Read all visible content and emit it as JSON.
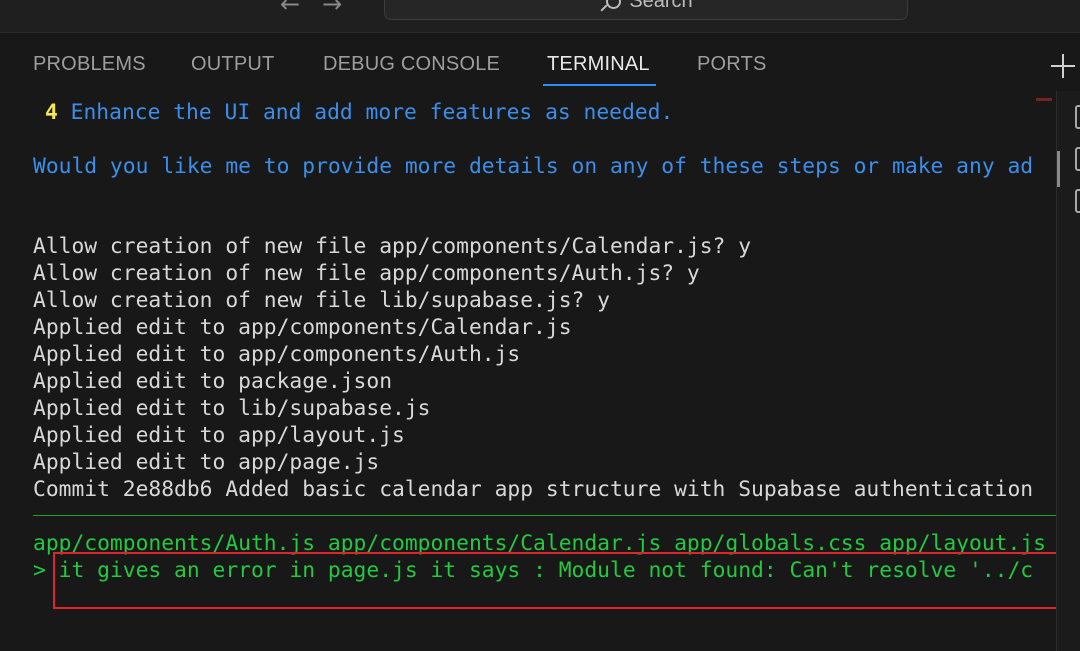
{
  "titlebar": {
    "back_glyph": "←",
    "forward_glyph": "→",
    "search_label": "Search"
  },
  "panel": {
    "tabs": [
      {
        "label": "PROBLEMS"
      },
      {
        "label": "OUTPUT"
      },
      {
        "label": "DEBUG CONSOLE"
      },
      {
        "label": "TERMINAL",
        "active": true
      },
      {
        "label": "PORTS"
      }
    ],
    "new_terminal_icon": "plus-icon"
  },
  "terminal": {
    "step_number": "4",
    "step_text": "Enhance the UI and add more features as needed.",
    "question": "Would you like me to provide more details on any of these steps or make any ad",
    "output_lines": [
      "Allow creation of new file app/components/Calendar.js? y",
      "Allow creation of new file app/components/Auth.js? y",
      "Allow creation of new file lib/supabase.js? y",
      "Applied edit to app/components/Calendar.js",
      "Applied edit to app/components/Auth.js",
      "Applied edit to package.json",
      "Applied edit to lib/supabase.js",
      "Applied edit to app/layout.js",
      "Applied edit to app/page.js",
      "Commit 2e88db6 Added basic calendar app structure with Supabase authentication"
    ],
    "files_line": "app/components/Auth.js app/components/Calendar.js app/globals.css app/layout.js",
    "prompt_symbol": ">",
    "prompt_text": "it gives an error in page.js it says : Module not found: Can't resolve '../c"
  },
  "colors": {
    "accent": "#2b8cff",
    "highlight_border": "#e0242b",
    "terminal_green": "#23c93e",
    "terminal_blue": "#3b8eea",
    "terminal_yellow": "#f2e94e"
  }
}
